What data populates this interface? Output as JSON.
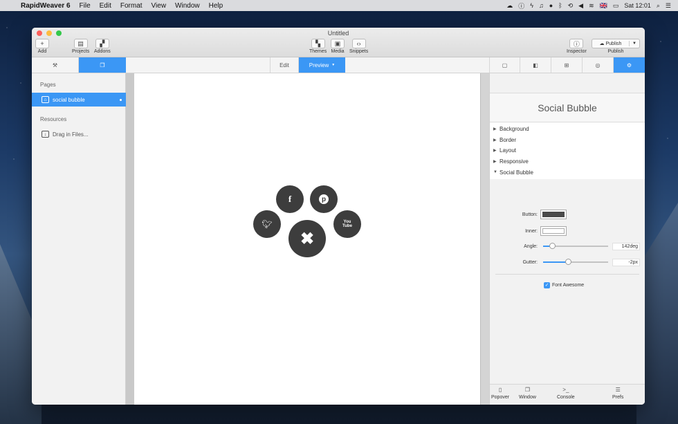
{
  "menubar": {
    "app_name": "RapidWeaver 6",
    "menus": [
      "File",
      "Edit",
      "Format",
      "View",
      "Window",
      "Help"
    ],
    "clock": "Sat 12:01",
    "input_flag": "🇬🇧"
  },
  "window": {
    "title": "Untitled",
    "toolbar": {
      "add": "Add",
      "projects": "Projects",
      "addons": "Addons",
      "themes": "Themes",
      "media": "Media",
      "snippets": "Snippets",
      "inspector": "Inspector",
      "publish_button": "Publish",
      "publish_label": "Publish"
    },
    "mode_tabs": {
      "edit": "Edit",
      "preview": "Preview"
    }
  },
  "sidebar": {
    "pages_header": "Pages",
    "pages": [
      {
        "label": "social bubble"
      }
    ],
    "resources_header": "Resources",
    "resources": [
      {
        "label": "Drag in Files..."
      }
    ]
  },
  "inspector": {
    "title": "Social Bubble",
    "sections": [
      {
        "label": "Background",
        "expanded": false
      },
      {
        "label": "Border",
        "expanded": false
      },
      {
        "label": "Layout",
        "expanded": false
      },
      {
        "label": "Responsive",
        "expanded": false
      },
      {
        "label": "Social Bubble",
        "expanded": true
      }
    ],
    "props": {
      "button_label": "Button:",
      "button_color": "#4a4a4a",
      "inner_label": "Inner:",
      "inner_color": "#ffffff",
      "angle_label": "Angle:",
      "angle_value": "142deg",
      "angle_fraction": 0.1,
      "gutter_label": "Gutter:",
      "gutter_value": "-2px",
      "gutter_fraction": 0.38,
      "font_awesome_label": "Font Awesome",
      "font_awesome_checked": true
    },
    "footer": {
      "popover": "Popover",
      "window": "Window",
      "console": "Console",
      "prefs": "Prefs"
    }
  },
  "canvas": {
    "bubbles": [
      "facebook-icon",
      "pinterest-icon",
      "twitter-icon",
      "close-icon",
      "youtube-icon"
    ],
    "youtube_text": "You Tube",
    "bubble_color": "#3d3d3d"
  },
  "colors": {
    "accent": "#3b97f5"
  }
}
